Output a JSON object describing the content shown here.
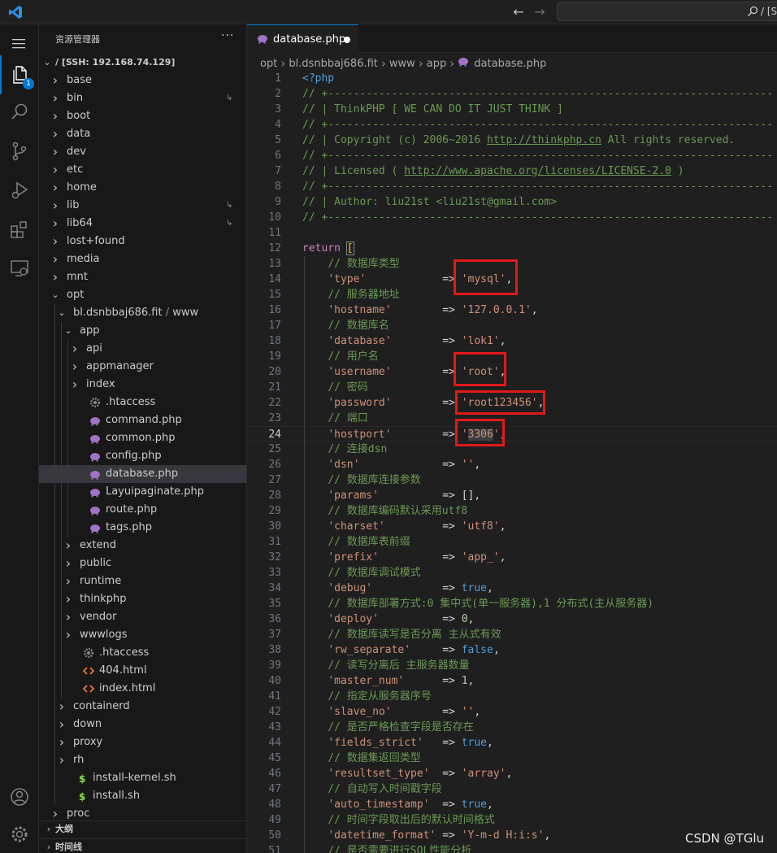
{
  "titlebar": {
    "command_center_text": "/ [SS"
  },
  "activity": {
    "explorer_badge": "1"
  },
  "sidebar": {
    "title": "资源管理器",
    "more": "···",
    "root": "/ [SSH: 192.168.74.129]",
    "items": [
      {
        "label": "base",
        "depth": 1,
        "kind": "folder",
        "open": false
      },
      {
        "label": "bin",
        "depth": 1,
        "kind": "folder",
        "open": false,
        "symlink": true
      },
      {
        "label": "boot",
        "depth": 1,
        "kind": "folder",
        "open": false
      },
      {
        "label": "data",
        "depth": 1,
        "kind": "folder",
        "open": false
      },
      {
        "label": "dev",
        "depth": 1,
        "kind": "folder",
        "open": false
      },
      {
        "label": "etc",
        "depth": 1,
        "kind": "folder",
        "open": false
      },
      {
        "label": "home",
        "depth": 1,
        "kind": "folder",
        "open": false
      },
      {
        "label": "lib",
        "depth": 1,
        "kind": "folder",
        "open": false,
        "symlink": true
      },
      {
        "label": "lib64",
        "depth": 1,
        "kind": "folder",
        "open": false,
        "symlink": true
      },
      {
        "label": "lost+found",
        "depth": 1,
        "kind": "folder",
        "open": false
      },
      {
        "label": "media",
        "depth": 1,
        "kind": "folder",
        "open": false
      },
      {
        "label": "mnt",
        "depth": 1,
        "kind": "folder",
        "open": false
      },
      {
        "label": "opt",
        "depth": 1,
        "kind": "folder",
        "open": true
      },
      {
        "label": "bl.dsnbbaj686.fit",
        "label2": "www",
        "depth": 2,
        "kind": "folder",
        "open": true
      },
      {
        "label": "app",
        "depth": 3,
        "kind": "folder",
        "open": true
      },
      {
        "label": "api",
        "depth": 4,
        "kind": "folder",
        "open": false
      },
      {
        "label": "appmanager",
        "depth": 4,
        "kind": "folder",
        "open": false
      },
      {
        "label": "index",
        "depth": 4,
        "kind": "folder",
        "open": false
      },
      {
        "label": ".htaccess",
        "depth": 4,
        "kind": "gear"
      },
      {
        "label": "command.php",
        "depth": 4,
        "kind": "php"
      },
      {
        "label": "common.php",
        "depth": 4,
        "kind": "php"
      },
      {
        "label": "config.php",
        "depth": 4,
        "kind": "php"
      },
      {
        "label": "database.php",
        "depth": 4,
        "kind": "php",
        "selected": true
      },
      {
        "label": "Layuipaginate.php",
        "depth": 4,
        "kind": "php"
      },
      {
        "label": "route.php",
        "depth": 4,
        "kind": "php"
      },
      {
        "label": "tags.php",
        "depth": 4,
        "kind": "php"
      },
      {
        "label": "extend",
        "depth": 3,
        "kind": "folder",
        "open": false
      },
      {
        "label": "public",
        "depth": 3,
        "kind": "folder",
        "open": false
      },
      {
        "label": "runtime",
        "depth": 3,
        "kind": "folder",
        "open": false
      },
      {
        "label": "thinkphp",
        "depth": 3,
        "kind": "folder",
        "open": false
      },
      {
        "label": "vendor",
        "depth": 3,
        "kind": "folder",
        "open": false
      },
      {
        "label": "wwwlogs",
        "depth": 3,
        "kind": "folder",
        "open": false
      },
      {
        "label": ".htaccess",
        "depth": 3,
        "kind": "gear"
      },
      {
        "label": "404.html",
        "depth": 3,
        "kind": "html"
      },
      {
        "label": "index.html",
        "depth": 3,
        "kind": "html"
      },
      {
        "label": "containerd",
        "depth": 2,
        "kind": "folder",
        "open": false
      },
      {
        "label": "down",
        "depth": 2,
        "kind": "folder",
        "open": false
      },
      {
        "label": "proxy",
        "depth": 2,
        "kind": "folder",
        "open": false
      },
      {
        "label": "rh",
        "depth": 2,
        "kind": "folder",
        "open": false
      },
      {
        "label": "install-kernel.sh",
        "depth": 2,
        "kind": "sh"
      },
      {
        "label": "install.sh",
        "depth": 2,
        "kind": "sh"
      },
      {
        "label": "proc",
        "depth": 1,
        "kind": "folder",
        "open": false
      }
    ],
    "outline_label": "大纲",
    "timeline_label": "时间线"
  },
  "editor": {
    "tab_label": "database.php",
    "breadcrumb": [
      "opt",
      "bl.dsnbbaj686.fit",
      "www",
      "app",
      "database.php"
    ],
    "current_line": 24,
    "lines": [
      [
        [
          "php",
          "<?php"
        ]
      ],
      [
        [
          "cmt",
          "// +----------------------------------------------------------------------"
        ]
      ],
      [
        [
          "cmt",
          "// | ThinkPHP [ WE CAN DO IT JUST THINK ]"
        ]
      ],
      [
        [
          "cmt",
          "// +----------------------------------------------------------------------"
        ]
      ],
      [
        [
          "cmt",
          "// | Copyright (c) 2006~2016 "
        ],
        [
          "cmtlink",
          "http://thinkphp.cn"
        ],
        [
          "cmt",
          " All rights reserved."
        ]
      ],
      [
        [
          "cmt",
          "// +----------------------------------------------------------------------"
        ]
      ],
      [
        [
          "cmt",
          "// | Licensed ( "
        ],
        [
          "cmtlink",
          "http://www.apache.org/licenses/LICENSE-2.0"
        ],
        [
          "cmt",
          " )"
        ]
      ],
      [
        [
          "cmt",
          "// +----------------------------------------------------------------------"
        ]
      ],
      [
        [
          "cmt",
          "// | Author: liu21st <liu21st@gmail.com>"
        ]
      ],
      [
        [
          "cmt",
          "// +----------------------------------------------------------------------"
        ]
      ],
      [],
      [
        [
          "kw",
          "return"
        ],
        [
          "op",
          " "
        ],
        [
          "brk",
          "["
        ]
      ],
      [
        [
          "op",
          "    "
        ],
        [
          "cmt",
          "// 数据库类型"
        ]
      ],
      [
        [
          "op",
          "    "
        ],
        [
          "str",
          "'type'"
        ],
        [
          "op",
          "            => "
        ],
        [
          "str",
          "'mysql'"
        ],
        [
          "op",
          ","
        ]
      ],
      [
        [
          "op",
          "    "
        ],
        [
          "cmt",
          "// 服务器地址"
        ]
      ],
      [
        [
          "op",
          "    "
        ],
        [
          "str",
          "'hostname'"
        ],
        [
          "op",
          "        => "
        ],
        [
          "str",
          "'127.0.0.1'"
        ],
        [
          "op",
          ","
        ]
      ],
      [
        [
          "op",
          "    "
        ],
        [
          "cmt",
          "// 数据库名"
        ]
      ],
      [
        [
          "op",
          "    "
        ],
        [
          "str",
          "'database'"
        ],
        [
          "op",
          "        => "
        ],
        [
          "str",
          "'lok1'"
        ],
        [
          "op",
          ","
        ]
      ],
      [
        [
          "op",
          "    "
        ],
        [
          "cmt",
          "// 用户名"
        ]
      ],
      [
        [
          "op",
          "    "
        ],
        [
          "str",
          "'username'"
        ],
        [
          "op",
          "        => "
        ],
        [
          "str",
          "'root'"
        ],
        [
          "op",
          ","
        ]
      ],
      [
        [
          "op",
          "    "
        ],
        [
          "cmt",
          "// 密码"
        ]
      ],
      [
        [
          "op",
          "    "
        ],
        [
          "str",
          "'password'"
        ],
        [
          "op",
          "        => "
        ],
        [
          "str",
          "'root123456'"
        ],
        [
          "op",
          ","
        ]
      ],
      [
        [
          "op",
          "    "
        ],
        [
          "cmt",
          "// 端口"
        ]
      ],
      [
        [
          "op",
          "    "
        ],
        [
          "str",
          "'hostport'"
        ],
        [
          "op",
          "        => "
        ],
        [
          "str",
          "'"
        ],
        [
          "strhl",
          "3306"
        ],
        [
          "str",
          "'"
        ],
        [
          "op",
          ","
        ]
      ],
      [
        [
          "op",
          "    "
        ],
        [
          "cmt",
          "// 连接dsn"
        ]
      ],
      [
        [
          "op",
          "    "
        ],
        [
          "str",
          "'dsn'"
        ],
        [
          "op",
          "             => "
        ],
        [
          "str",
          "''"
        ],
        [
          "op",
          ","
        ]
      ],
      [
        [
          "op",
          "    "
        ],
        [
          "cmt",
          "// 数据库连接参数"
        ]
      ],
      [
        [
          "op",
          "    "
        ],
        [
          "str",
          "'params'"
        ],
        [
          "op",
          "          => "
        ],
        [
          "op",
          "[],"
        ]
      ],
      [
        [
          "op",
          "    "
        ],
        [
          "cmt",
          "// 数据库编码默认采用utf8"
        ]
      ],
      [
        [
          "op",
          "    "
        ],
        [
          "str",
          "'charset'"
        ],
        [
          "op",
          "         => "
        ],
        [
          "str",
          "'utf8'"
        ],
        [
          "op",
          ","
        ]
      ],
      [
        [
          "op",
          "    "
        ],
        [
          "cmt",
          "// 数据库表前缀"
        ]
      ],
      [
        [
          "op",
          "    "
        ],
        [
          "str",
          "'prefix'"
        ],
        [
          "op",
          "          => "
        ],
        [
          "str",
          "'app_'"
        ],
        [
          "op",
          ","
        ]
      ],
      [
        [
          "op",
          "    "
        ],
        [
          "cmt",
          "// 数据库调试模式"
        ]
      ],
      [
        [
          "op",
          "    "
        ],
        [
          "str",
          "'debug'"
        ],
        [
          "op",
          "           => "
        ],
        [
          "bool",
          "true"
        ],
        [
          "op",
          ","
        ]
      ],
      [
        [
          "op",
          "    "
        ],
        [
          "cmt",
          "// 数据库部署方式:0 集中式(单一服务器),1 分布式(主从服务器)"
        ]
      ],
      [
        [
          "op",
          "    "
        ],
        [
          "str",
          "'deploy'"
        ],
        [
          "op",
          "          => "
        ],
        [
          "num",
          "0"
        ],
        [
          "op",
          ","
        ]
      ],
      [
        [
          "op",
          "    "
        ],
        [
          "cmt",
          "// 数据库读写是否分离 主从式有效"
        ]
      ],
      [
        [
          "op",
          "    "
        ],
        [
          "str",
          "'rw_separate'"
        ],
        [
          "op",
          "     => "
        ],
        [
          "bool",
          "false"
        ],
        [
          "op",
          ","
        ]
      ],
      [
        [
          "op",
          "    "
        ],
        [
          "cmt",
          "// 读写分离后 主服务器数量"
        ]
      ],
      [
        [
          "op",
          "    "
        ],
        [
          "str",
          "'master_num'"
        ],
        [
          "op",
          "      => "
        ],
        [
          "num",
          "1"
        ],
        [
          "op",
          ","
        ]
      ],
      [
        [
          "op",
          "    "
        ],
        [
          "cmt",
          "// 指定从服务器序号"
        ]
      ],
      [
        [
          "op",
          "    "
        ],
        [
          "str",
          "'slave_no'"
        ],
        [
          "op",
          "        => "
        ],
        [
          "str",
          "''"
        ],
        [
          "op",
          ","
        ]
      ],
      [
        [
          "op",
          "    "
        ],
        [
          "cmt",
          "// 是否严格检查字段是否存在"
        ]
      ],
      [
        [
          "op",
          "    "
        ],
        [
          "str",
          "'fields_strict'"
        ],
        [
          "op",
          "   => "
        ],
        [
          "bool",
          "true"
        ],
        [
          "op",
          ","
        ]
      ],
      [
        [
          "op",
          "    "
        ],
        [
          "cmt",
          "// 数据集返回类型"
        ]
      ],
      [
        [
          "op",
          "    "
        ],
        [
          "str",
          "'resultset_type'"
        ],
        [
          "op",
          "  => "
        ],
        [
          "str",
          "'array'"
        ],
        [
          "op",
          ","
        ]
      ],
      [
        [
          "op",
          "    "
        ],
        [
          "cmt",
          "// 自动写入时间戳字段"
        ]
      ],
      [
        [
          "op",
          "    "
        ],
        [
          "str",
          "'auto_timestamp'"
        ],
        [
          "op",
          "  => "
        ],
        [
          "bool",
          "true"
        ],
        [
          "op",
          ","
        ]
      ],
      [
        [
          "op",
          "    "
        ],
        [
          "cmt",
          "// 时间字段取出后的默认时间格式"
        ]
      ],
      [
        [
          "op",
          "    "
        ],
        [
          "str",
          "'datetime_format'"
        ],
        [
          "op",
          " => "
        ],
        [
          "str",
          "'Y-m-d H:i:s'"
        ],
        [
          "op",
          ","
        ]
      ],
      [
        [
          "op",
          "    "
        ],
        [
          "cmt",
          "// 是否需要进行SQL性能分析"
        ]
      ]
    ]
  },
  "watermark": "CSDN @TGlu"
}
